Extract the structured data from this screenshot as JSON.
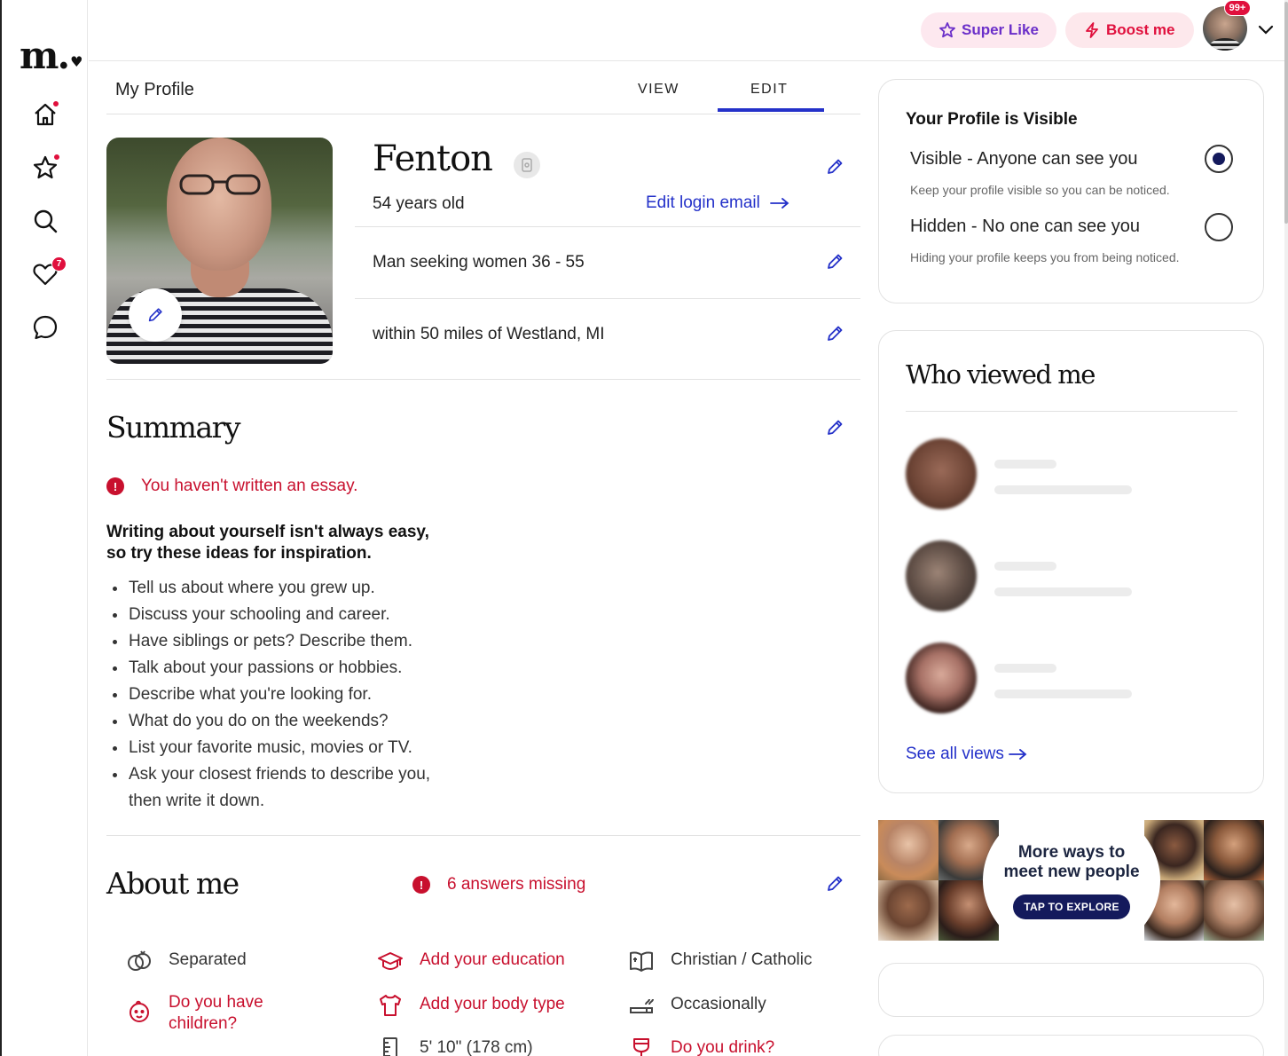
{
  "brand": {
    "logo_text": "m."
  },
  "nav": {
    "items": [
      {
        "name": "home",
        "badge": "dot"
      },
      {
        "name": "favorites",
        "badge": "dot"
      },
      {
        "name": "search",
        "badge": ""
      },
      {
        "name": "likes",
        "badge": "7"
      },
      {
        "name": "messages",
        "badge": ""
      }
    ]
  },
  "header": {
    "super_like_label": "Super Like",
    "boost_label": "Boost me",
    "notification_badge": "99+"
  },
  "tabs": {
    "page_title": "My Profile",
    "view_label": "VIEW",
    "edit_label": "EDIT",
    "active": "EDIT"
  },
  "profile": {
    "name": "Fenton",
    "age": "54 years old",
    "edit_login_email": "Edit login email",
    "seeking": "Man seeking women 36 - 55",
    "location": "within 50 miles of Westland, MI"
  },
  "summary": {
    "title": "Summary",
    "alert": "You haven't written an essay.",
    "inspiration_line1": "Writing about yourself isn't always easy,",
    "inspiration_line2": "so try these ideas for inspiration.",
    "tips": [
      "Tell us about where you grew up.",
      "Discuss your schooling and career.",
      "Have siblings or pets? Describe them.",
      "Talk about your passions or hobbies.",
      "Describe what you're looking for.",
      "What do you do on the weekends?",
      "List your favorite music, movies or TV.",
      "Ask your closest friends to describe you,",
      "then write it down."
    ]
  },
  "about": {
    "title": "About me",
    "alert": "6 answers missing",
    "items": [
      {
        "label": "Separated",
        "icon": "rings-icon",
        "missing": false
      },
      {
        "label": "Add your education",
        "icon": "graduation-cap-icon",
        "missing": true
      },
      {
        "label": "Christian / Catholic",
        "icon": "book-icon",
        "missing": false
      },
      {
        "label": "Do you have children?",
        "label_line1": "Do you have",
        "label_line2": "children?",
        "icon": "baby-icon",
        "missing": true
      },
      {
        "label": "Add your body type",
        "icon": "shirt-icon",
        "missing": true
      },
      {
        "label": "Occasionally",
        "icon": "smoking-icon",
        "missing": false
      },
      {
        "label": "5' 10\" (178 cm)",
        "icon": "ruler-icon",
        "missing": false
      },
      {
        "label": "Do you drink?",
        "icon": "wine-icon",
        "missing": true
      }
    ]
  },
  "visibility": {
    "title": "Your Profile is Visible",
    "visible_label": "Visible - Anyone can see you",
    "visible_sub": "Keep your profile visible so you can be noticed.",
    "hidden_label": "Hidden - No one can see you",
    "hidden_sub": "Hiding your profile keeps you from being noticed.",
    "selected": "visible"
  },
  "who_viewed": {
    "title": "Who viewed me",
    "see_all": "See all views"
  },
  "promo": {
    "title_line1": "More ways to",
    "title_line2": "meet new people",
    "button": "TAP TO EXPLORE"
  },
  "colors": {
    "accent_blue": "#2431c9",
    "alert_red": "#c8102e",
    "badge_red": "#e0103d",
    "navy": "#141a5c",
    "super_like_purple": "#6b2fc9"
  }
}
